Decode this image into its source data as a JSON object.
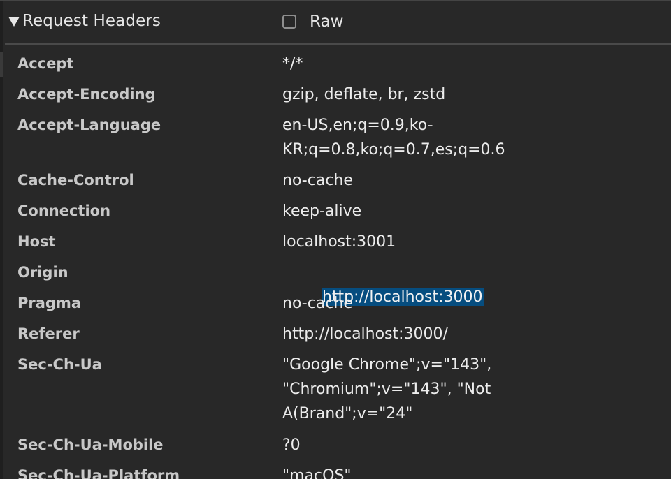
{
  "section": {
    "title": "Request Headers",
    "raw_label": "Raw",
    "raw_checked": false
  },
  "headers": [
    {
      "name": "Accept",
      "value": "*/*",
      "selected": false
    },
    {
      "name": "Accept-Encoding",
      "value": "gzip, deflate, br, zstd",
      "selected": false
    },
    {
      "name": "Accept-Language",
      "value": "en-US,en;q=0.9,ko-\nKR;q=0.8,ko;q=0.7,es;q=0.6",
      "selected": false
    },
    {
      "name": "Cache-Control",
      "value": "no-cache",
      "selected": false
    },
    {
      "name": "Connection",
      "value": "keep-alive",
      "selected": false
    },
    {
      "name": "Host",
      "value": "localhost:3001",
      "selected": false
    },
    {
      "name": "Origin",
      "value": "http://localhost:3000",
      "selected": true
    },
    {
      "name": "Pragma",
      "value": "no-cache",
      "selected": false
    },
    {
      "name": "Referer",
      "value": "http://localhost:3000/",
      "selected": false
    },
    {
      "name": "Sec-Ch-Ua",
      "value": "\"Google Chrome\";v=\"143\",\n\"Chromium\";v=\"143\", \"Not\nA(Brand\";v=\"24\"",
      "selected": false
    },
    {
      "name": "Sec-Ch-Ua-Mobile",
      "value": "?0",
      "selected": false
    },
    {
      "name": "Sec-Ch-Ua-Platform",
      "value": "\"macOS\"",
      "selected": false
    }
  ],
  "colors": {
    "background": "#282828",
    "selection": "#064d7f",
    "text": "#e6e6e6"
  }
}
